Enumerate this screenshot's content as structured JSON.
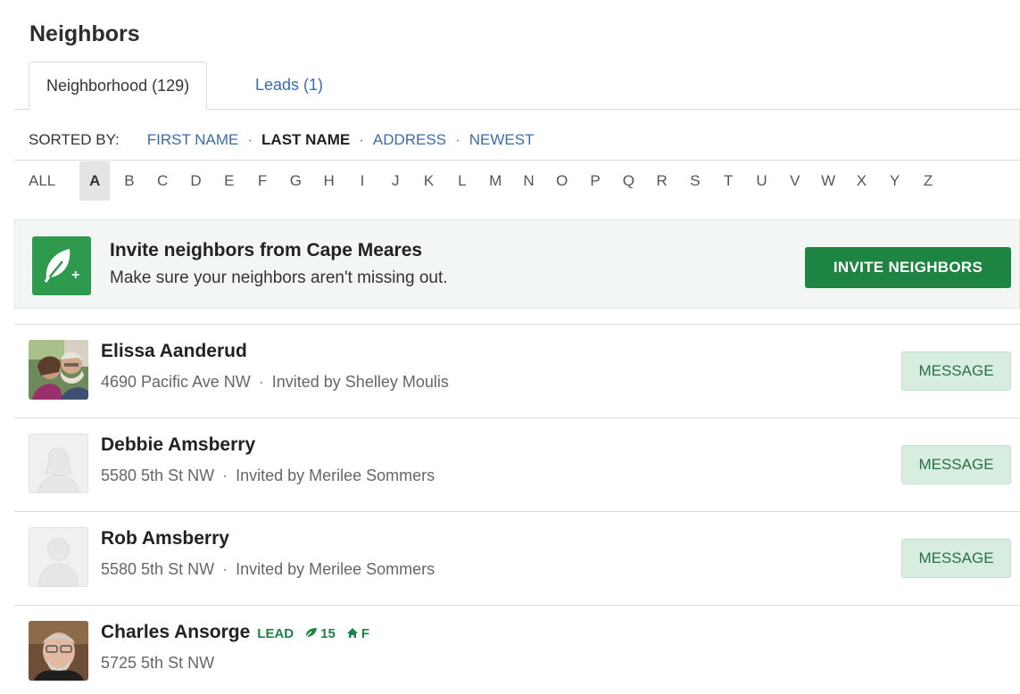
{
  "page": {
    "title": "Neighbors"
  },
  "tabs": [
    {
      "label": "Neighborhood (129)",
      "active": true
    },
    {
      "label": "Leads (1)",
      "active": false
    }
  ],
  "sort": {
    "label": "SORTED BY:",
    "options": [
      {
        "label": "FIRST NAME",
        "active": false
      },
      {
        "label": "LAST NAME",
        "active": true
      },
      {
        "label": "ADDRESS",
        "active": false
      },
      {
        "label": "NEWEST",
        "active": false
      }
    ],
    "separator": "·"
  },
  "alphabet": {
    "all_label": "ALL",
    "letters": [
      "A",
      "B",
      "C",
      "D",
      "E",
      "F",
      "G",
      "H",
      "I",
      "J",
      "K",
      "L",
      "M",
      "N",
      "O",
      "P",
      "Q",
      "R",
      "S",
      "T",
      "U",
      "V",
      "W",
      "X",
      "Y",
      "Z"
    ],
    "active": "A"
  },
  "invite": {
    "icon": "leaf-plus-icon",
    "title": "Invite neighbors from Cape Meares",
    "subtitle": "Make sure your neighbors aren't missing out.",
    "button_label": "INVITE NEIGHBORS"
  },
  "neighbors": [
    {
      "name": "Elissa Aanderud",
      "address": "4690 Pacific Ave NW",
      "invited": "Invited by Shelley Moulis",
      "avatar": "photo-couple",
      "message_label": "MESSAGE"
    },
    {
      "name": "Debbie Amsberry",
      "address": "5580 5th St NW",
      "invited": "Invited by Merilee Sommers",
      "avatar": "placeholder-female",
      "message_label": "MESSAGE"
    },
    {
      "name": "Rob Amsberry",
      "address": "5580 5th St NW",
      "invited": "Invited by Merilee Sommers",
      "avatar": "placeholder-male",
      "message_label": "MESSAGE"
    },
    {
      "name": "Charles Ansorge",
      "address": "5725 5th St NW",
      "avatar": "photo-man",
      "lead_label": "LEAD",
      "leaf_count": "15",
      "home_label": "F"
    }
  ],
  "colors": {
    "brand_green": "#1e8443",
    "link_blue": "#3a6bb0",
    "banner_bg": "#f2f7f5",
    "message_bg": "#d7ede0"
  }
}
